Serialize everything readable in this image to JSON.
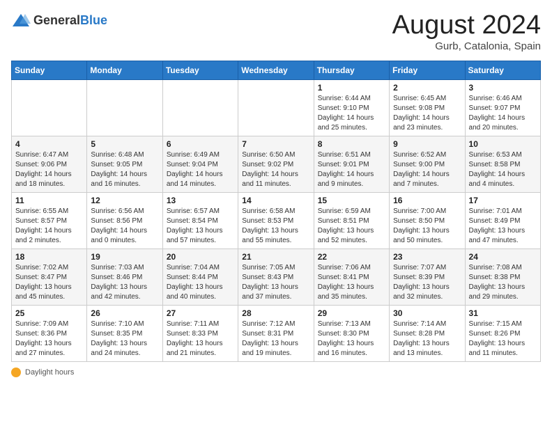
{
  "logo": {
    "general": "General",
    "blue": "Blue"
  },
  "title": {
    "month_year": "August 2024",
    "location": "Gurb, Catalonia, Spain"
  },
  "weekdays": [
    "Sunday",
    "Monday",
    "Tuesday",
    "Wednesday",
    "Thursday",
    "Friday",
    "Saturday"
  ],
  "weeks": [
    [
      {
        "day": "",
        "detail": ""
      },
      {
        "day": "",
        "detail": ""
      },
      {
        "day": "",
        "detail": ""
      },
      {
        "day": "",
        "detail": ""
      },
      {
        "day": "1",
        "detail": "Sunrise: 6:44 AM\nSunset: 9:10 PM\nDaylight: 14 hours and 25 minutes."
      },
      {
        "day": "2",
        "detail": "Sunrise: 6:45 AM\nSunset: 9:08 PM\nDaylight: 14 hours and 23 minutes."
      },
      {
        "day": "3",
        "detail": "Sunrise: 6:46 AM\nSunset: 9:07 PM\nDaylight: 14 hours and 20 minutes."
      }
    ],
    [
      {
        "day": "4",
        "detail": "Sunrise: 6:47 AM\nSunset: 9:06 PM\nDaylight: 14 hours and 18 minutes."
      },
      {
        "day": "5",
        "detail": "Sunrise: 6:48 AM\nSunset: 9:05 PM\nDaylight: 14 hours and 16 minutes."
      },
      {
        "day": "6",
        "detail": "Sunrise: 6:49 AM\nSunset: 9:04 PM\nDaylight: 14 hours and 14 minutes."
      },
      {
        "day": "7",
        "detail": "Sunrise: 6:50 AM\nSunset: 9:02 PM\nDaylight: 14 hours and 11 minutes."
      },
      {
        "day": "8",
        "detail": "Sunrise: 6:51 AM\nSunset: 9:01 PM\nDaylight: 14 hours and 9 minutes."
      },
      {
        "day": "9",
        "detail": "Sunrise: 6:52 AM\nSunset: 9:00 PM\nDaylight: 14 hours and 7 minutes."
      },
      {
        "day": "10",
        "detail": "Sunrise: 6:53 AM\nSunset: 8:58 PM\nDaylight: 14 hours and 4 minutes."
      }
    ],
    [
      {
        "day": "11",
        "detail": "Sunrise: 6:55 AM\nSunset: 8:57 PM\nDaylight: 14 hours and 2 minutes."
      },
      {
        "day": "12",
        "detail": "Sunrise: 6:56 AM\nSunset: 8:56 PM\nDaylight: 14 hours and 0 minutes."
      },
      {
        "day": "13",
        "detail": "Sunrise: 6:57 AM\nSunset: 8:54 PM\nDaylight: 13 hours and 57 minutes."
      },
      {
        "day": "14",
        "detail": "Sunrise: 6:58 AM\nSunset: 8:53 PM\nDaylight: 13 hours and 55 minutes."
      },
      {
        "day": "15",
        "detail": "Sunrise: 6:59 AM\nSunset: 8:51 PM\nDaylight: 13 hours and 52 minutes."
      },
      {
        "day": "16",
        "detail": "Sunrise: 7:00 AM\nSunset: 8:50 PM\nDaylight: 13 hours and 50 minutes."
      },
      {
        "day": "17",
        "detail": "Sunrise: 7:01 AM\nSunset: 8:49 PM\nDaylight: 13 hours and 47 minutes."
      }
    ],
    [
      {
        "day": "18",
        "detail": "Sunrise: 7:02 AM\nSunset: 8:47 PM\nDaylight: 13 hours and 45 minutes."
      },
      {
        "day": "19",
        "detail": "Sunrise: 7:03 AM\nSunset: 8:46 PM\nDaylight: 13 hours and 42 minutes."
      },
      {
        "day": "20",
        "detail": "Sunrise: 7:04 AM\nSunset: 8:44 PM\nDaylight: 13 hours and 40 minutes."
      },
      {
        "day": "21",
        "detail": "Sunrise: 7:05 AM\nSunset: 8:43 PM\nDaylight: 13 hours and 37 minutes."
      },
      {
        "day": "22",
        "detail": "Sunrise: 7:06 AM\nSunset: 8:41 PM\nDaylight: 13 hours and 35 minutes."
      },
      {
        "day": "23",
        "detail": "Sunrise: 7:07 AM\nSunset: 8:39 PM\nDaylight: 13 hours and 32 minutes."
      },
      {
        "day": "24",
        "detail": "Sunrise: 7:08 AM\nSunset: 8:38 PM\nDaylight: 13 hours and 29 minutes."
      }
    ],
    [
      {
        "day": "25",
        "detail": "Sunrise: 7:09 AM\nSunset: 8:36 PM\nDaylight: 13 hours and 27 minutes."
      },
      {
        "day": "26",
        "detail": "Sunrise: 7:10 AM\nSunset: 8:35 PM\nDaylight: 13 hours and 24 minutes."
      },
      {
        "day": "27",
        "detail": "Sunrise: 7:11 AM\nSunset: 8:33 PM\nDaylight: 13 hours and 21 minutes."
      },
      {
        "day": "28",
        "detail": "Sunrise: 7:12 AM\nSunset: 8:31 PM\nDaylight: 13 hours and 19 minutes."
      },
      {
        "day": "29",
        "detail": "Sunrise: 7:13 AM\nSunset: 8:30 PM\nDaylight: 13 hours and 16 minutes."
      },
      {
        "day": "30",
        "detail": "Sunrise: 7:14 AM\nSunset: 8:28 PM\nDaylight: 13 hours and 13 minutes."
      },
      {
        "day": "31",
        "detail": "Sunrise: 7:15 AM\nSunset: 8:26 PM\nDaylight: 13 hours and 11 minutes."
      }
    ]
  ],
  "footer": {
    "label": "Daylight hours"
  }
}
